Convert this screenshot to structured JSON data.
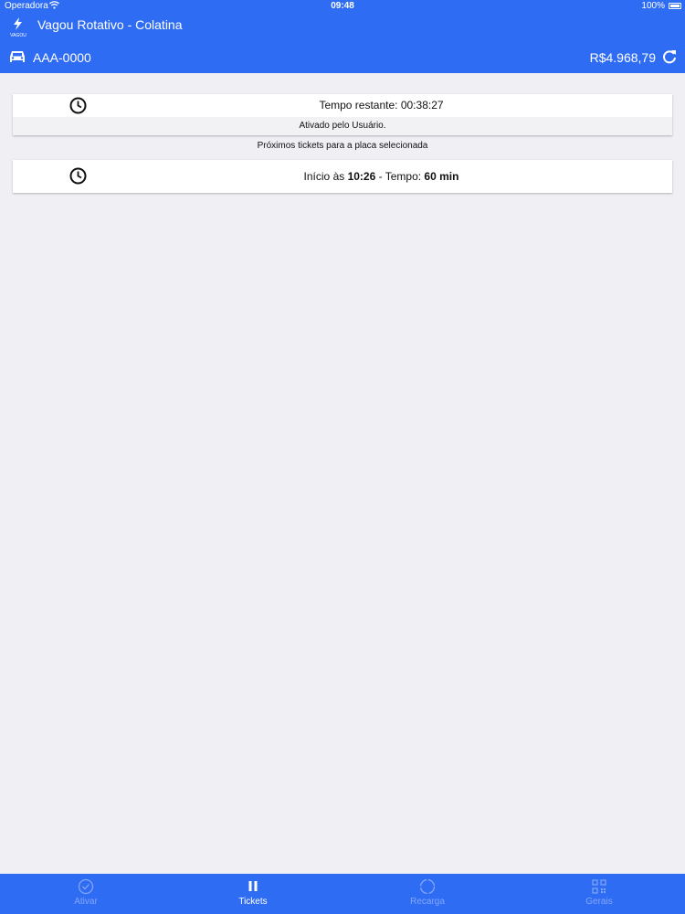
{
  "status_bar": {
    "carrier": "Operadora",
    "time": "09:48",
    "battery": "100%"
  },
  "header": {
    "app_title": "Vagou Rotativo - Colatina",
    "logo_text": "VAGOU",
    "plate": "AAA-0000",
    "balance": "R$4.968,79"
  },
  "active_ticket": {
    "remaining": "Tempo restante: 00:38:27",
    "activated_by": "Ativado pelo Usuário."
  },
  "next_section_label": "Próximos tickets para a placa selecionada",
  "next_ticket": {
    "start_prefix": "Início às ",
    "start_time": "10:26",
    "sep": " - Tempo: ",
    "duration": "60 min"
  },
  "tabs": [
    {
      "label": "Ativar",
      "icon": "check-circle-icon",
      "active": false
    },
    {
      "label": "Tickets",
      "icon": "pause-icon",
      "active": true
    },
    {
      "label": "Recarga",
      "icon": "refresh-circle-icon",
      "active": false
    },
    {
      "label": "Gerais",
      "icon": "qr-code-icon",
      "active": false
    }
  ],
  "colors": {
    "accent": "#2f6cf4",
    "background": "#efeff4",
    "tab_inactive": "#84a6f8"
  }
}
